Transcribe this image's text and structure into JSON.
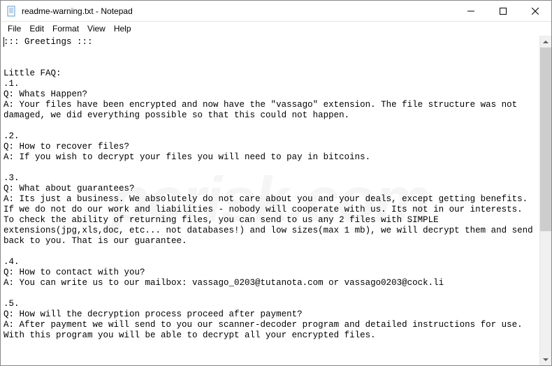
{
  "titlebar": {
    "title": "readme-warning.txt - Notepad"
  },
  "menubar": {
    "file": "File",
    "edit": "Edit",
    "format": "Format",
    "view": "View",
    "help": "Help"
  },
  "content": {
    "text": "::: Greetings :::\n\n\nLittle FAQ:\n.1.\nQ: Whats Happen?\nA: Your files have been encrypted and now have the \"vassago\" extension. The file structure was not damaged, we did everything possible so that this could not happen.\n\n.2.\nQ: How to recover files?\nA: If you wish to decrypt your files you will need to pay in bitcoins.\n\n.3.\nQ: What about guarantees?\nA: Its just a business. We absolutely do not care about you and your deals, except getting benefits. If we do not do our work and liabilities - nobody will cooperate with us. Its not in our interests.\nTo check the ability of returning files, you can send to us any 2 files with SIMPLE extensions(jpg,xls,doc, etc... not databases!) and low sizes(max 1 mb), we will decrypt them and send back to you. That is our guarantee.\n\n.4.\nQ: How to contact with you?\nA: You can write us to our mailbox: vassago_0203@tutanota.com or vassago0203@cock.li\n\n.5.\nQ: How will the decryption process proceed after payment?\nA: After payment we will send to you our scanner-decoder program and detailed instructions for use. With this program you will be able to decrypt all your encrypted files."
  },
  "watermark": "pcrisk.com"
}
